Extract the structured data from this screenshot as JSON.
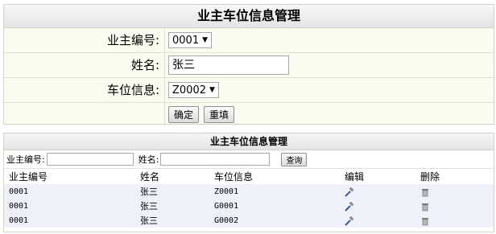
{
  "form": {
    "title": "业主车位信息管理",
    "owner_id_label": "业主编号:",
    "owner_id_value": "0001",
    "name_label": "姓名:",
    "name_value": "张三",
    "parking_label": "车位信息:",
    "parking_value": "Z0002",
    "confirm_label": "确定",
    "reset_label": "重填"
  },
  "list": {
    "title": "业主车位信息管理",
    "search_owner_label": "业主编号:",
    "search_name_label": "姓名:",
    "query_label": "查询",
    "columns": [
      "业主编号",
      "姓名",
      "车位信息",
      "编辑",
      "删除"
    ],
    "rows": [
      {
        "owner_id": "0001",
        "name": "张三",
        "parking": "Z0001"
      },
      {
        "owner_id": "0001",
        "name": "张三",
        "parking": "G0001"
      },
      {
        "owner_id": "0001",
        "name": "张三",
        "parking": "G0002"
      }
    ],
    "edit_icon": "edit-icon",
    "delete_icon": "trash-icon"
  }
}
